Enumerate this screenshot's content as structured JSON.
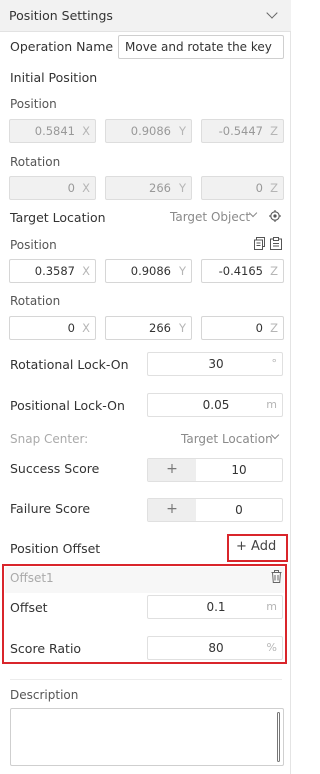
{
  "header": {
    "title": "Position Settings"
  },
  "operation": {
    "label": "Operation Name",
    "value": "Move and rotate the key"
  },
  "initial": {
    "heading": "Initial Position",
    "position_label": "Position",
    "position": {
      "x": "0.5841",
      "y": "0.9086",
      "z": "-0.5447"
    },
    "rotation_label": "Rotation",
    "rotation": {
      "x": "0",
      "y": "266",
      "z": "0"
    }
  },
  "axes": {
    "x": "X",
    "y": "Y",
    "z": "Z"
  },
  "target": {
    "label": "Target Location",
    "dropdown_value": "Target Object",
    "position_label": "Position",
    "position": {
      "x": "0.3587",
      "y": "0.9086",
      "z": "-0.4165"
    },
    "rotation_label": "Rotation",
    "rotation": {
      "x": "0",
      "y": "266",
      "z": "0"
    }
  },
  "rotational_lock": {
    "label": "Rotational Lock-On",
    "value": "30",
    "unit": "°"
  },
  "positional_lock": {
    "label": "Positional Lock-On",
    "value": "0.05",
    "unit": "m"
  },
  "snap_center": {
    "label": "Snap Center:",
    "value": "Target Location"
  },
  "success_score": {
    "label": "Success Score",
    "plus": "+",
    "value": "10"
  },
  "failure_score": {
    "label": "Failure Score",
    "plus": "+",
    "value": "0"
  },
  "position_offset": {
    "label": "Position Offset",
    "add_label": "+ Add"
  },
  "offset_item": {
    "name": "Offset1",
    "offset_label": "Offset",
    "offset_value": "0.1",
    "offset_unit": "m",
    "ratio_label": "Score Ratio",
    "ratio_value": "80",
    "ratio_unit": "%"
  },
  "description": {
    "label": "Description"
  },
  "colors": {
    "highlight": "#d9252b",
    "header_bg": "#f2f2f2"
  },
  "icons": [
    "chevron-down-icon",
    "target-crosshair-icon",
    "copy-icon",
    "paste-icon",
    "trash-icon"
  ]
}
